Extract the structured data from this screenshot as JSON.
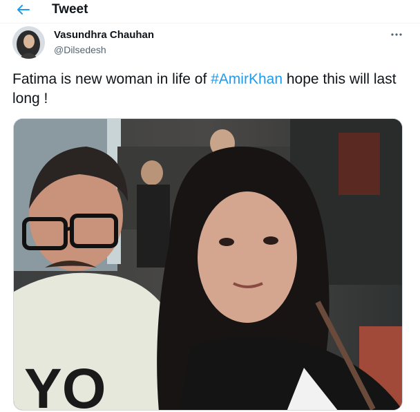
{
  "header": {
    "title": "Tweet",
    "back_icon": "arrow-left-icon"
  },
  "author": {
    "display_name": "Vasundhra Chauhan",
    "handle": "@Dilsedesh"
  },
  "tweet": {
    "text_before": "Fatima is new woman in life of ",
    "hashtag": "#AmirKhan",
    "text_after": " hope this will last long !"
  },
  "media": {
    "shirt_text": "YO"
  },
  "colors": {
    "accent": "#1d9bf0",
    "text": "#0f1419",
    "secondary_text": "#536471"
  },
  "icons": {
    "more": "more-horizontal-icon"
  }
}
